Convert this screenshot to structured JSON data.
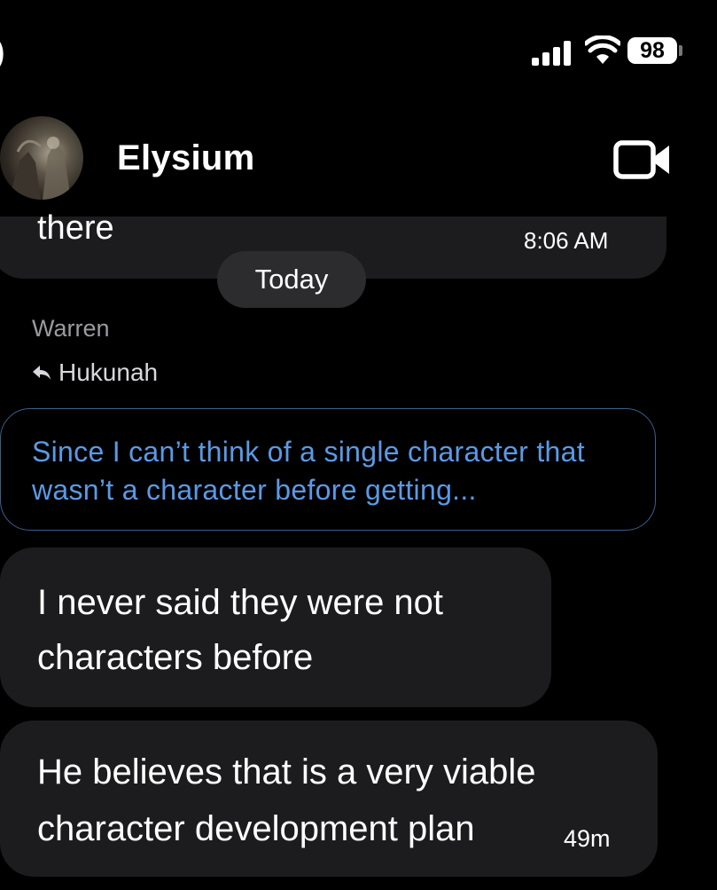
{
  "status_bar": {
    "left_glyph": ")",
    "battery_level": "98",
    "signal_icon": "cellular-signal-icon",
    "wifi_icon": "wifi-icon"
  },
  "header": {
    "chat_name": "Elysium",
    "video_icon": "video-camera-icon"
  },
  "messages": {
    "previous": {
      "text": "there",
      "time": "8:06 AM"
    },
    "day_separator": "Today",
    "sender": "Warren",
    "reply": {
      "to": "Hukunah",
      "quoted_text": "Since I can’t think of a single character that wasn’t a character before getting..."
    },
    "items": [
      {
        "text": "I never said they were not characters before"
      },
      {
        "text": "He believes that is a very viable character development plan",
        "time": "49m"
      }
    ]
  },
  "colors": {
    "background": "#000000",
    "bubble": "#1c1c1e",
    "quote_text": "#5a9ae6",
    "quote_border": "#3b5e8f",
    "sender": "#9a9aa0"
  }
}
